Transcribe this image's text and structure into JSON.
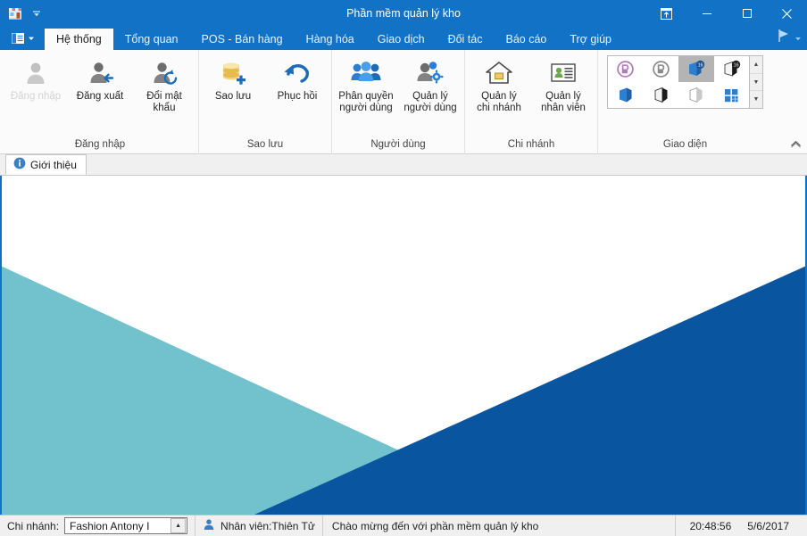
{
  "window": {
    "title": "Phần mềm quản lý kho",
    "app_icon": "shop-icon",
    "qat_dropdown_icon": "chevron-down-icon",
    "buttons": {
      "ribbon_display": "ribbon-display-options-icon",
      "minimize": "minimize-icon",
      "maximize": "maximize-icon",
      "close": "close-icon"
    }
  },
  "tabstrip": {
    "menu_button_icon": "layout-menu-icon",
    "right_button_icon": "play-flag-icon",
    "tabs": [
      {
        "label": "Hệ thống",
        "active": true
      },
      {
        "label": "Tổng quan",
        "active": false
      },
      {
        "label": "POS - Bán hàng",
        "active": false
      },
      {
        "label": "Hàng hóa",
        "active": false
      },
      {
        "label": "Giao dịch",
        "active": false
      },
      {
        "label": "Đối tác",
        "active": false
      },
      {
        "label": "Báo cáo",
        "active": false
      },
      {
        "label": "Trợ giúp",
        "active": false
      }
    ]
  },
  "ribbon": {
    "collapse_icon": "chevron-up-icon",
    "groups": [
      {
        "label": "Đăng nhập",
        "items": [
          {
            "label": "Đăng nhập",
            "icon": "user-login-icon",
            "disabled": true
          },
          {
            "label": "Đăng xuất",
            "icon": "user-logout-icon",
            "disabled": false
          },
          {
            "label": "Đổi mật\nkhẩu",
            "icon": "user-password-reset-icon",
            "disabled": false
          }
        ]
      },
      {
        "label": "Sao lưu",
        "items": [
          {
            "label": "Sao lưu",
            "icon": "database-add-icon",
            "disabled": false
          },
          {
            "label": "Phục hồi",
            "icon": "restore-undo-icon",
            "disabled": false
          }
        ]
      },
      {
        "label": "Người dùng",
        "items": [
          {
            "label": "Phân quyền\nngười dùng",
            "icon": "user-group-icon",
            "disabled": false
          },
          {
            "label": "Quản lý\nngười dùng",
            "icon": "user-settings-icon",
            "disabled": false
          }
        ]
      },
      {
        "label": "Chi nhánh",
        "items": [
          {
            "label": "Quản lý\nchi nhánh",
            "icon": "home-branch-icon",
            "disabled": false
          },
          {
            "label": "Quản lý\nnhân viên",
            "icon": "employee-card-icon",
            "disabled": false
          }
        ]
      }
    ],
    "gallery": {
      "label": "Giao diện",
      "scroll_up_icon": "scroll-up-icon",
      "scroll_down_icon": "scroll-down-icon",
      "scroll_more_icon": "scroll-more-icon",
      "items": [
        {
          "icon": "theme-office-purple-icon",
          "selected": false
        },
        {
          "icon": "theme-office-grey-icon",
          "selected": false
        },
        {
          "icon": "theme-office-2016-blue-icon",
          "selected": true
        },
        {
          "icon": "theme-office-2016-black-icon",
          "selected": false
        },
        {
          "icon": "theme-office-2013-blue-icon",
          "selected": false
        },
        {
          "icon": "theme-office-2013-black-icon",
          "selected": false
        },
        {
          "icon": "theme-office-2013-white-icon",
          "selected": false
        },
        {
          "icon": "theme-metro-tiles-icon",
          "selected": false
        }
      ]
    }
  },
  "doctabs": [
    {
      "label": "Giới thiệu",
      "icon": "info-icon",
      "active": true
    }
  ],
  "content": {
    "teal_color": "#72c2cd",
    "blue_color": "#0a559f",
    "background_color": "#ffffff"
  },
  "statusbar": {
    "branch_label": "Chi nhánh:",
    "branch_value": "Fashion Antony I",
    "branch_dropdown_icon": "chevron-up-icon",
    "employee_icon": "user-icon",
    "employee_label": "Nhân viên:Thiên Tử",
    "welcome_message": "Chào mừng đến với phần mềm quản lý kho",
    "time": "20:48:56",
    "date": "5/6/2017"
  }
}
